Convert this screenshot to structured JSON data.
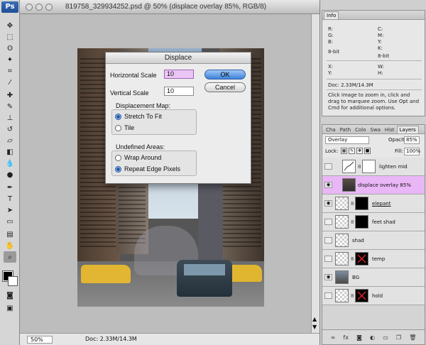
{
  "app": {
    "logo": "Ps"
  },
  "document": {
    "title": "819758_329934252.psd @ 50% (displace overlay 85%, RGB/8)",
    "zoom": "50%",
    "doc_size": "Doc: 2.33M/14.3M"
  },
  "dialog": {
    "title": "Displace",
    "horizontal_scale_label": "Horizontal Scale",
    "horizontal_scale_value": "10",
    "vertical_scale_label": "Vertical Scale",
    "vertical_scale_value": "10",
    "ok_label": "OK",
    "cancel_label": "Cancel",
    "displacement_map_label": "Displacement Map:",
    "stretch_label": "Stretch To Fit",
    "tile_label": "Tile",
    "undefined_areas_label": "Undefined Areas:",
    "wrap_label": "Wrap Around",
    "repeat_label": "Repeat Edge Pixels"
  },
  "info_panel": {
    "tab": "Info",
    "r": "R:",
    "g": "G:",
    "b": "B:",
    "c": "C:",
    "m": "M:",
    "y": "Y:",
    "k": "K:",
    "bit_left": "8-bit",
    "bit_right": "8-bit",
    "x": "X:",
    "y2": "Y:",
    "w": "W:",
    "h": "H:",
    "doc": "Doc: 2.33M/14.3M",
    "hint": "Click image to zoom in, click and drag to marquee zoom.  Use Opt and Cmd for additional options."
  },
  "layers_panel": {
    "tabs": [
      "Cha",
      "Path",
      "Colo",
      "Swa",
      "Hist",
      "Layers"
    ],
    "blend_mode": "Overlay",
    "opacity_label": "Opacity:",
    "opacity": "85%",
    "lock_label": "Lock:",
    "fill_label": "Fill:",
    "fill": "100%",
    "layers": [
      {
        "name": "lighten mid",
        "visible": false
      },
      {
        "name": "displace overlay 85%",
        "visible": true
      },
      {
        "name": "elepant",
        "visible": true
      },
      {
        "name": "feet shad",
        "visible": false
      },
      {
        "name": "shad",
        "visible": false
      },
      {
        "name": "temp",
        "visible": false
      },
      {
        "name": "BG",
        "visible": true
      },
      {
        "name": "hold",
        "visible": false
      }
    ],
    "footer_icons": [
      "link-layers",
      "fx",
      "add-mask",
      "adjustment",
      "group",
      "new-layer",
      "delete"
    ]
  },
  "colors": {
    "selected_layer": "#e9b6f6",
    "input_focus": "#eac6f4",
    "ok_button": "#3c82d8"
  }
}
